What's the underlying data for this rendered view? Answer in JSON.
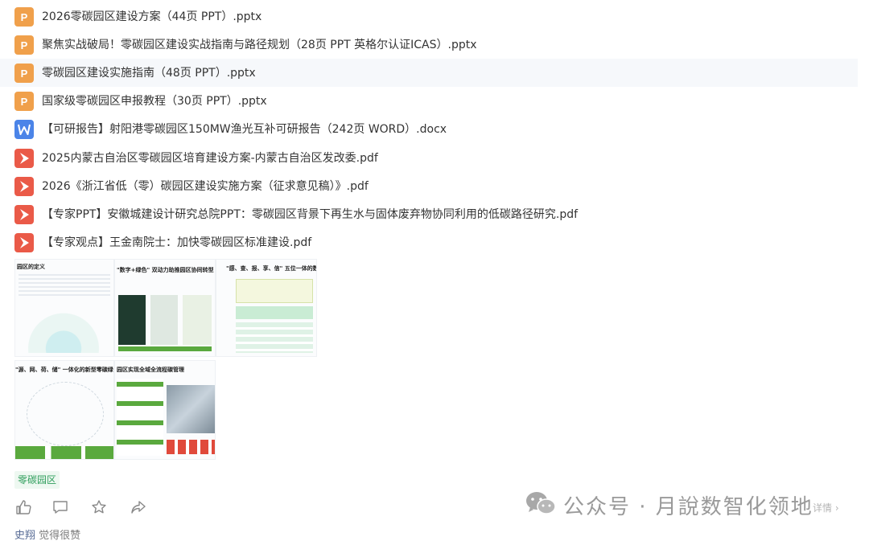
{
  "files": [
    {
      "type": "pptx",
      "icon": "ppt-file-icon",
      "name": "2026零碳园区建设方案（44页 PPT）.pptx",
      "highlight": false
    },
    {
      "type": "pptx",
      "icon": "ppt-file-icon",
      "name": "聚焦实战破局！零碳园区建设实战指南与路径规划（28页 PPT 英格尔认证ICAS）.pptx",
      "highlight": false
    },
    {
      "type": "pptx",
      "icon": "ppt-file-icon",
      "name": "零碳园区建设实施指南（48页 PPT）.pptx",
      "highlight": true
    },
    {
      "type": "pptx",
      "icon": "ppt-file-icon",
      "name": "国家级零碳园区申报教程（30页 PPT）.pptx",
      "highlight": false
    },
    {
      "type": "docx",
      "icon": "word-file-icon",
      "name": "【可研报告】射阳港零碳园区150MW渔光互补可研报告（242页 WORD）.docx",
      "highlight": false
    },
    {
      "type": "pdf",
      "icon": "pdf-file-icon",
      "name": "2025内蒙古自治区零碳园区培育建设方案-内蒙古自治区发改委.pdf",
      "highlight": false
    },
    {
      "type": "pdf",
      "icon": "pdf-file-icon",
      "name": "2026《浙江省低（零）碳园区建设实施方案（征求意见稿）》.pdf",
      "highlight": false
    },
    {
      "type": "pdf",
      "icon": "pdf-file-icon",
      "name": "【专家PPT】安徽城建设计研究总院PPT：零碳园区背景下再生水与固体废弃物协同利用的低碳路径研究.pdf",
      "highlight": false
    },
    {
      "type": "pdf",
      "icon": "pdf-file-icon",
      "name": "【专家观点】王金南院士：加快零碳园区标准建设.pdf",
      "highlight": false
    }
  ],
  "thumbnails": [
    {
      "title": "园区的定义"
    },
    {
      "title": "\"数字+绿色\" 双动力助推园区协同转型"
    },
    {
      "title": "\"感、查、报、享、信\" 五位一体的数字"
    },
    {
      "title": "\"源、网、荷、储\" 一体化的新型零碳绿色"
    },
    {
      "title": "园区实现全域全流程碳管理"
    }
  ],
  "tag": {
    "label": "零碳园区"
  },
  "actions": [
    {
      "name": "like-icon"
    },
    {
      "name": "comment-icon"
    },
    {
      "name": "favorite-icon"
    },
    {
      "name": "share-icon"
    }
  ],
  "brand": {
    "text": "公众号 · 月說数智化领地"
  },
  "more_label": "详情 ›",
  "liker": {
    "name": "史翔",
    "suffix": " 觉得很赞"
  },
  "colors": {
    "ppt": "#f0a04b",
    "word": "#4b84e8",
    "pdf": "#ea5a48",
    "tag_bg": "#eef8f1",
    "tag_text": "#2f9e5c",
    "link": "#576b95"
  }
}
